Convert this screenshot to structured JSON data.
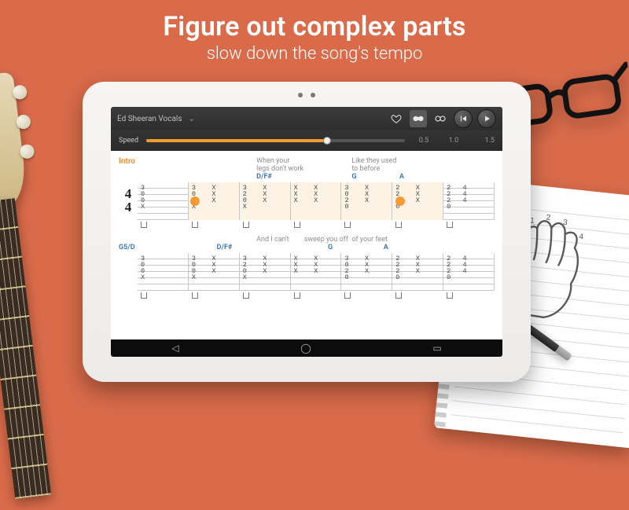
{
  "promo": {
    "headline": "Figure out complex parts",
    "subhead": "slow down the song's tempo"
  },
  "player": {
    "track": "Ed Sheeran Vocals",
    "liked": false,
    "instrument": "guitar",
    "loop_on": false
  },
  "speed": {
    "label": "Speed",
    "ticks": [
      "",
      "0.5",
      "1.0",
      "1.5"
    ],
    "value": 1.0
  },
  "section1": {
    "label": "Intro",
    "lyric_cells": [
      "",
      "",
      "When your legs don't work",
      "",
      "Like they used to before",
      "",
      ""
    ],
    "chord_cells": [
      "",
      "",
      "D/F#",
      "",
      "G",
      "A",
      ""
    ],
    "timesig_top": "4",
    "timesig_bot": "4",
    "bars": [
      {
        "nums": "3\n0\n0\nX",
        "highlight": false
      },
      {
        "nums": "3    X\n0    X\n0    X\nX",
        "highlight": true,
        "cursor": 0.12
      },
      {
        "nums": "3    X\n2    X\n0    X\nX",
        "highlight": true
      },
      {
        "nums": "X    X\nX    X\nX    X\n",
        "highlight": true
      },
      {
        "nums": "3    X\n0    X\n2    X\n0",
        "highlight": true
      },
      {
        "nums": "2    X\n2    X\n2    X\n0",
        "highlight": true,
        "cursor": 0.15
      },
      {
        "nums": "2   4\n2   4\n2   4\n0",
        "highlight": false
      }
    ]
  },
  "section2": {
    "lyric_cells": [
      "",
      "",
      "And I can't",
      "sweep you off",
      "of your feet",
      "",
      ""
    ],
    "chord_cells": [
      "G5/D",
      "",
      "D/F#",
      "",
      "G",
      "A",
      ""
    ],
    "bars": [
      {
        "nums": "3\n0\n0\nX"
      },
      {
        "nums": "3    X\n0    X\n0    X\nX"
      },
      {
        "nums": "3    X\n2    X\n0    X\nX"
      },
      {
        "nums": "X    X\nX    X\nX    X"
      },
      {
        "nums": "3    X\n0    X\n2    X\n0"
      },
      {
        "nums": "2    X\n2    X\n2    X\n0"
      },
      {
        "nums": "2   4\n2   4\n2   4\n0"
      }
    ]
  },
  "notebook_labels": [
    "1",
    "2",
    "3",
    "4"
  ]
}
